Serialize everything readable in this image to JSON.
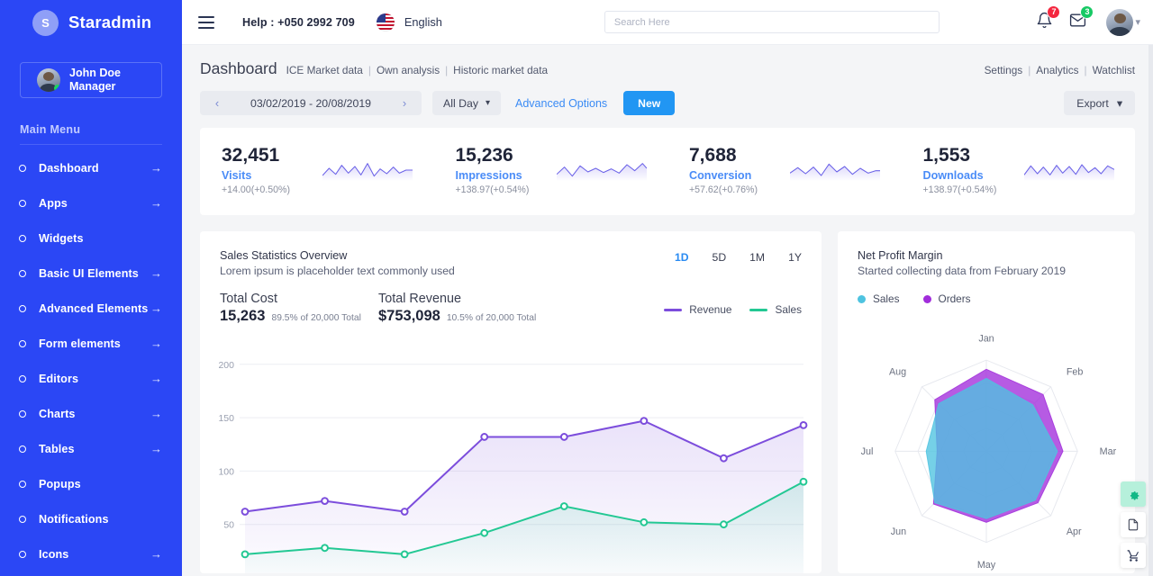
{
  "sidebar": {
    "brand": {
      "initial": "S",
      "name": "Staradmin"
    },
    "user": {
      "name": "John Doe",
      "role": "Manager",
      "status": "online"
    },
    "menu_title": "Main Menu",
    "items": [
      {
        "label": "Dashboard",
        "arrow": "→"
      },
      {
        "label": "Apps",
        "arrow": "→"
      },
      {
        "label": "Widgets",
        "arrow": ""
      },
      {
        "label": "Basic UI Elements",
        "arrow": "→"
      },
      {
        "label": "Advanced Elements",
        "arrow": "→"
      },
      {
        "label": "Form elements",
        "arrow": "→"
      },
      {
        "label": "Editors",
        "arrow": "→"
      },
      {
        "label": "Charts",
        "arrow": "→"
      },
      {
        "label": "Tables",
        "arrow": "→"
      },
      {
        "label": "Popups",
        "arrow": ""
      },
      {
        "label": "Notifications",
        "arrow": ""
      },
      {
        "label": "Icons",
        "arrow": "→"
      }
    ]
  },
  "topbar": {
    "help": "Help : +050 2992 709",
    "language": "English",
    "search_placeholder": "Search Here",
    "notifications_count": "7",
    "messages_count": "3"
  },
  "page": {
    "title": "Dashboard",
    "breadcrumbs": [
      "ICE Market data",
      "Own analysis",
      "Historic market data"
    ],
    "header_links": [
      "Settings",
      "Analytics",
      "Watchlist"
    ]
  },
  "toolbar": {
    "date_range": "03/02/2019 - 20/08/2019",
    "prev_icon": "‹",
    "next_icon": "›",
    "day_filter": "All Day",
    "advanced_options": "Advanced Options",
    "new_button": "New",
    "export": "Export"
  },
  "stats": [
    {
      "value": "32,451",
      "label": "Visits",
      "delta": "+14.00(+0.50%)"
    },
    {
      "value": "15,236",
      "label": "Impressions",
      "delta": "+138.97(+0.54%)"
    },
    {
      "value": "7,688",
      "label": "Conversion",
      "delta": "+57.62(+0.76%)"
    },
    {
      "value": "1,553",
      "label": "Downloads",
      "delta": "+138.97(+0.54%)"
    }
  ],
  "sales_panel": {
    "title": "Sales Statistics Overview",
    "subtitle": "Lorem ipsum is placeholder text commonly used",
    "total_cost_label": "Total Cost",
    "total_cost_value": "15,263",
    "total_cost_note": "89.5% of 20,000 Total",
    "total_revenue_label": "Total Revenue",
    "total_revenue_value": "$753,098",
    "total_revenue_note": "10.5% of 20,000 Total",
    "tabs": [
      "1D",
      "5D",
      "1M",
      "1Y"
    ],
    "active_tab": "1D"
  },
  "radar_panel": {
    "title": "Net Profit Margin",
    "subtitle": "Started collecting data from February 2019",
    "legend": [
      {
        "name": "Sales",
        "color": "#4ec3e0"
      },
      {
        "name": "Orders",
        "color": "#a12ddb"
      }
    ]
  },
  "float_buttons": [
    {
      "icon": "gear-icon",
      "glyph": "⚙"
    },
    {
      "icon": "document-icon",
      "glyph": "὜E"
    },
    {
      "icon": "cart-icon",
      "glyph": "Ὥ2"
    }
  ],
  "colors": {
    "sidebar_bg": "#2b47f5",
    "accent_blue": "#2196f3",
    "revenue_purple": "#7c4ddc",
    "sales_green": "#23c893",
    "radar_sales": "#4ec3e0",
    "radar_orders": "#a12ddb",
    "badge_red": "#f4273f",
    "badge_green": "#17c964"
  },
  "chart_data": [
    {
      "type": "area",
      "title": "Sales Statistics Overview",
      "x": [
        1,
        2,
        3,
        4,
        5,
        6,
        7,
        8
      ],
      "series": [
        {
          "name": "Revenue",
          "color": "#7c4ddc",
          "values": [
            62,
            72,
            62,
            132,
            132,
            147,
            112,
            143
          ]
        },
        {
          "name": "Sales",
          "color": "#23c893",
          "values": [
            22,
            28,
            22,
            42,
            67,
            52,
            50,
            90
          ]
        }
      ],
      "ylabel": "",
      "xlabel": "",
      "yticks": [
        50,
        100,
        150,
        200
      ],
      "ylim": [
        0,
        215
      ],
      "grid": true,
      "legend_position": "top-right"
    },
    {
      "type": "radar",
      "title": "Net Profit Margin",
      "categories": [
        "Jan",
        "Feb",
        "Mar",
        "Apr",
        "May",
        "Jun",
        "Jul",
        "Aug"
      ],
      "series": [
        {
          "name": "Sales",
          "color": "#4ec3e0",
          "values": [
            80,
            72,
            78,
            76,
            74,
            80,
            66,
            74
          ]
        },
        {
          "name": "Orders",
          "color": "#a12ddb",
          "values": [
            90,
            88,
            84,
            80,
            78,
            82,
            54,
            80
          ]
        }
      ],
      "rlim": [
        0,
        100
      ],
      "grid": true,
      "legend_position": "top-left"
    }
  ]
}
